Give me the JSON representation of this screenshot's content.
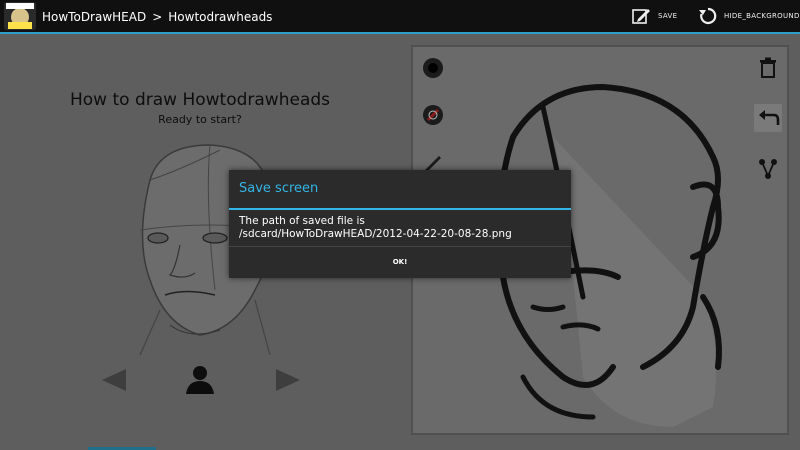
{
  "app": {
    "logo_lines": [
      "HOW TO",
      "DRAW",
      "HEAD"
    ],
    "breadcrumb": [
      "HowToDrawHEAD",
      "Howtodrawheads"
    ],
    "breadcrumb_separator": ">"
  },
  "actions": {
    "save_label": "SAVE",
    "hide_background_label": "HIDE_BACKGROUND"
  },
  "guide": {
    "title": "How to draw Howtodrawheads",
    "subtitle": "Ready to start?"
  },
  "tools": {
    "left": [
      "brush-size-icon",
      "color-picker-icon",
      "pencil-icon"
    ],
    "right": [
      "trash-icon",
      "undo-icon",
      "share-icon"
    ]
  },
  "dialog": {
    "title": "Save screen",
    "message_line1": "The path of saved file is",
    "message_line2": "/sdcard/HowToDrawHEAD/2012-04-22-20-08-28.png",
    "ok_label": "OK!"
  },
  "colors": {
    "accent": "#33b5e5",
    "actionbar": "#101010",
    "dialog_bg": "#2b2b2b",
    "dimmed_bg": "#5e5e5e"
  }
}
